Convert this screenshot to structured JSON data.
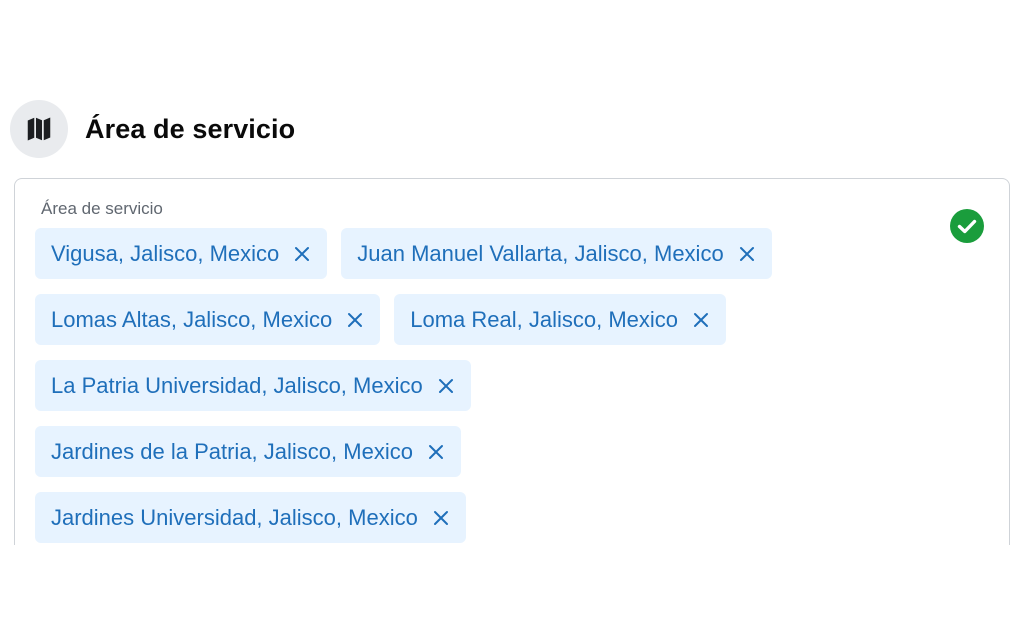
{
  "section": {
    "title": "Área de servicio",
    "icon": "map-icon"
  },
  "field": {
    "label": "Área de servicio",
    "status_icon": "check-circle-icon",
    "status_color": "#1a9d3c"
  },
  "chips": [
    {
      "label": "Vigusa, Jalisco, Mexico"
    },
    {
      "label": "Juan Manuel Vallarta, Jalisco, Mexico"
    },
    {
      "label": "Lomas Altas, Jalisco, Mexico"
    },
    {
      "label": "Loma Real, Jalisco, Mexico"
    },
    {
      "label": "La Patria Universidad, Jalisco, Mexico"
    },
    {
      "label": "Jardines de la Patria, Jalisco, Mexico"
    },
    {
      "label": "Jardines Universidad, Jalisco, Mexico"
    }
  ],
  "colors": {
    "chip_background": "#e7f3ff",
    "chip_text": "#1f6fba",
    "icon_circle": "#e9ebee"
  }
}
